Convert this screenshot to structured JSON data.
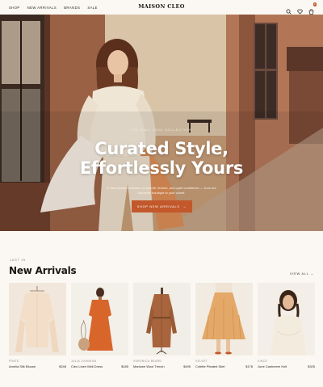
{
  "nav": {
    "links": [
      "SHOP",
      "NEW ARRIVALS",
      "BRANDS",
      "SALE"
    ],
    "brand": "MAISON CLEO",
    "cart_count": "2",
    "icons": [
      "search-icon",
      "heart-icon",
      "cart-icon"
    ]
  },
  "hero": {
    "eyebrow": "THE FALL 2026 COLLECTION",
    "title_line1": "Curated Style,",
    "title_line2": "Effortlessly Yours",
    "subtitle": "A hand-picked selection of warmth, texture, and quiet confidence — from our Nashville boutique to your closet.",
    "cta_label": "SHOP NEW ARRIVALS",
    "cta_arrow": "→"
  },
  "arrivals": {
    "eyebrow": "JUST IN",
    "title": "New Arrivals",
    "view_all": "VIEW ALL →",
    "products": [
      {
        "brand": "FRATE",
        "name": "Amelia Silk Blouse",
        "price": "$248"
      },
      {
        "brand": "JULIA JOHNSON",
        "name": "Cleo Linen Midi Dress",
        "price": "$185"
      },
      {
        "brand": "VERONICA BEARD",
        "name": "Marlowe Wool Trench",
        "price": "$495"
      },
      {
        "brand": "VELVET",
        "name": "Colette Pleated Skirt",
        "price": "$178"
      },
      {
        "brand": "VINCE",
        "name": "June Cashmere Knit",
        "price": "$325"
      }
    ]
  },
  "colors": {
    "accent": "#c2582b",
    "background": "#fbf8f3",
    "text": "#1f1a17"
  }
}
